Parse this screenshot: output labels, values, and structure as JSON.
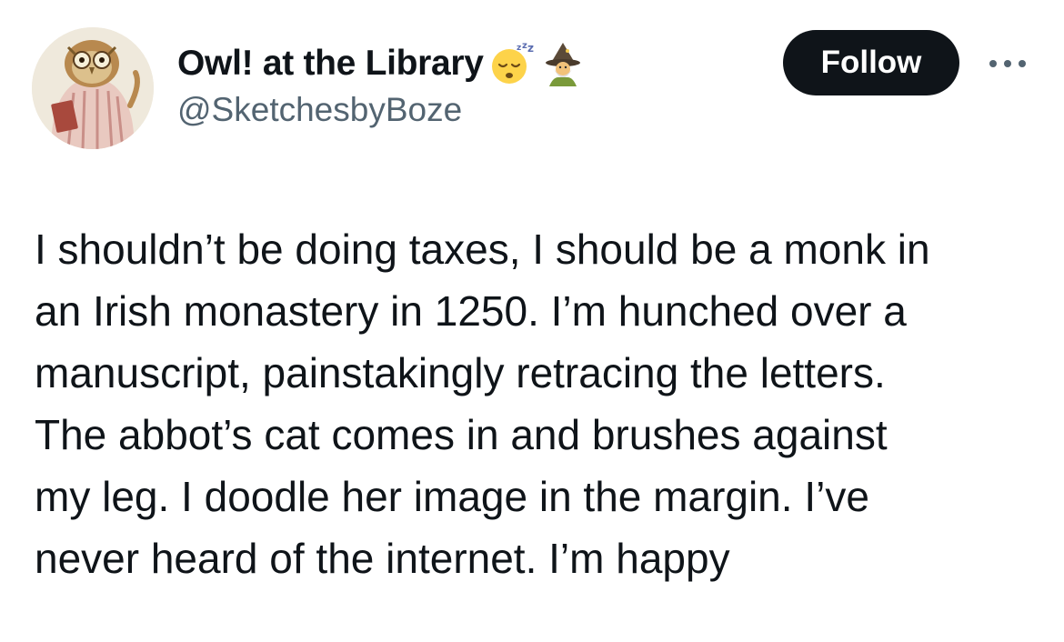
{
  "author": {
    "display_name": "Owl! at the Library",
    "handle": "@SketchesbyBoze",
    "avatar_icon": "owl-avatar",
    "name_emojis": [
      "sleeping-face-emoji",
      "mage-emoji"
    ]
  },
  "actions": {
    "follow_label": "Follow",
    "more_icon": "more-horizontal-icon"
  },
  "tweet": {
    "lines": [
      "I shouldn’t be doing taxes, I should be a monk in",
      "an Irish monastery in 1250. I’m hunched over a",
      "manuscript, painstakingly retracing the letters.",
      "The abbot’s cat comes in and brushes against",
      "my leg. I doodle her image in the margin. I’ve",
      "never heard of the internet. I’m happy"
    ]
  },
  "colors": {
    "text": "#0f1419",
    "secondary_text": "#536471",
    "follow_bg": "#0f1419",
    "follow_text": "#ffffff",
    "background": "#ffffff"
  }
}
